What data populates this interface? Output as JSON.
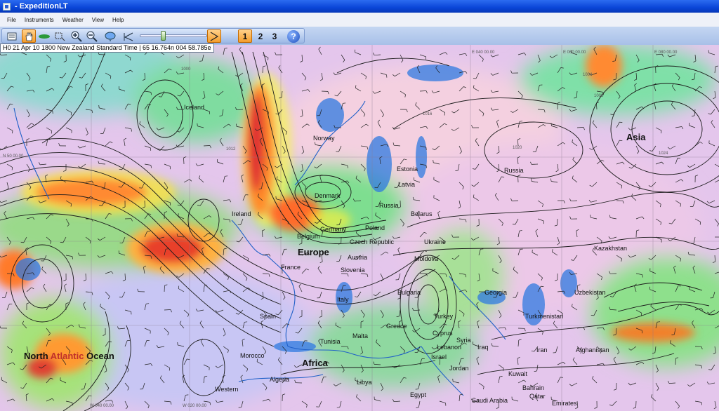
{
  "window": {
    "title": "- ExpeditionLT"
  },
  "menu": [
    "File",
    "Instruments",
    "Weather",
    "View",
    "Help"
  ],
  "toolbar": {
    "icons": [
      "list-icon",
      "hand-icon",
      "boat-icon",
      "rectangle-select-icon",
      "zoom-in-icon",
      "zoom-out-icon",
      "cloud-icon",
      "step-back-icon",
      "play-icon"
    ],
    "tabs": [
      "1",
      "2",
      "3"
    ],
    "help_label": "?"
  },
  "status_text": "H0  21 Apr 10  1800  New Zealand Standard Time | 65 16.764n  004 58.785e",
  "map": {
    "regions": [
      {
        "key": "europe",
        "text": "Europe"
      },
      {
        "key": "asia",
        "text": "Asia"
      },
      {
        "key": "africa",
        "text": "Africa"
      }
    ],
    "ocean": {
      "part1": "North ",
      "part2": "Atlantic",
      "part3": " Ocean"
    },
    "places": [
      "Norway",
      "Estonia",
      "Latvia",
      "Russia",
      "Denmark",
      "Belarus",
      "Poland",
      "Germany",
      "Czech Republic",
      "Ukraine",
      "Moldova",
      "Austria",
      "Slovenia",
      "Belgium",
      "France",
      "Italy",
      "Spain",
      "Bulgaria",
      "Turkey",
      "Georgia",
      "Kazakhstan",
      "Uzbekistan",
      "Turkmenistan",
      "Afghanistan",
      "Iran",
      "Iraq",
      "Syria",
      "Lebanon",
      "Israel",
      "Jordan",
      "Kuwait",
      "Qatar",
      "Bahrain",
      "Emirates",
      "Saudi Arabia",
      "Egypt",
      "Libya",
      "Tunisia",
      "Algeria",
      "Morocco",
      "Western",
      "Ireland",
      "Iceland",
      "Malta",
      "Greece",
      "Cyprus",
      "Russia"
    ],
    "grid_labels": [
      "N 50 00.00",
      "W 040 00.00",
      "W 020 00.00",
      "E 040 00.00",
      "E 060 00.00",
      "E 080 00.00"
    ],
    "isobar_labels": [
      "1016",
      "1020",
      "1012",
      "1008",
      "1024",
      "1004",
      "1000"
    ]
  }
}
